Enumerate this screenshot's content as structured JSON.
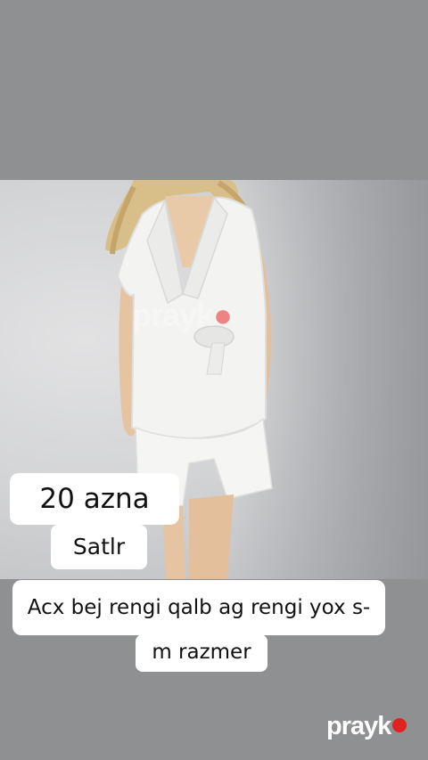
{
  "overlay": {
    "price_label": "20 azna",
    "sell_label": "Satlr",
    "description_line1": "Acx bej rengi qalb ag rengi yox s-",
    "description_line2": "m razmer"
  },
  "watermark": {
    "center_text": "prayk",
    "brand_text": "prayk"
  },
  "colors": {
    "background": "#8f9092",
    "bubble": "#ffffff",
    "brand_dot": "#e0221f"
  },
  "icons": [
    "brand-dot-icon"
  ]
}
